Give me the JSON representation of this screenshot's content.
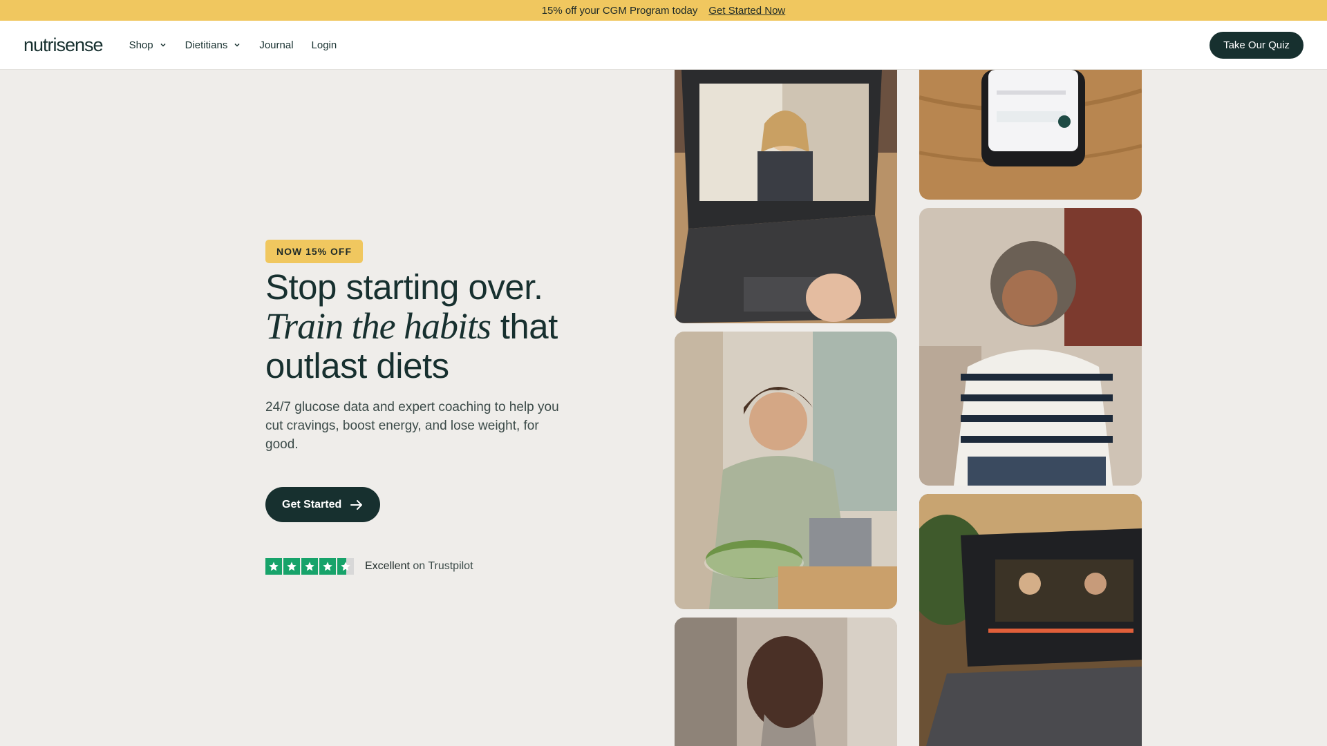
{
  "promo": {
    "text": "15% off your CGM Program today",
    "link": "Get Started Now"
  },
  "header": {
    "logo": "nutrisense",
    "nav": [
      {
        "label": "Shop",
        "has_dropdown": true
      },
      {
        "label": "Dietitians",
        "has_dropdown": true
      },
      {
        "label": "Journal",
        "has_dropdown": false
      },
      {
        "label": "Login",
        "has_dropdown": false
      }
    ],
    "cta": "Take Our Quiz"
  },
  "hero": {
    "badge": "NOW 15% OFF",
    "headline_line1": "Stop starting over.",
    "headline_italic": "Train the habits",
    "headline_rest": " that",
    "headline_line3": "outlast diets",
    "subtext": "24/7 glucose data and expert coaching  to help you cut cravings, boost energy, and lose weight, for good.",
    "button": "Get Started",
    "trust_strong": "Excellent",
    "trust_rest": " on Trustpilot",
    "trust_rating_stars": 4.5
  },
  "colors": {
    "promo_bg": "#f0c75f",
    "dark_green": "#17302f",
    "page_bg": "#efedea",
    "trustpilot_green": "#17a36a"
  }
}
